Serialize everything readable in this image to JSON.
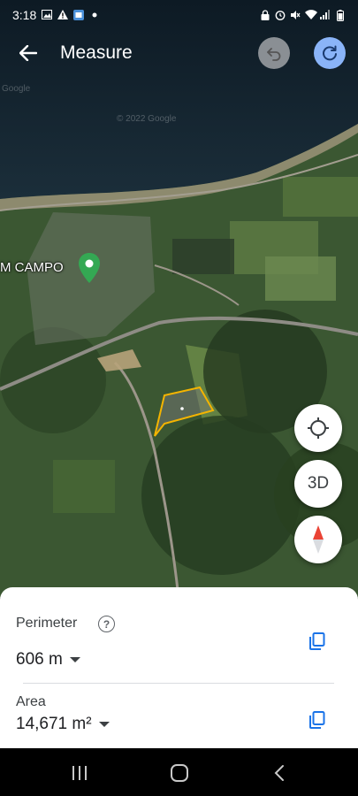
{
  "status_bar": {
    "time": "3:18",
    "left_icons": [
      "gallery-icon",
      "warning-icon",
      "app-icon",
      "dot-icon"
    ],
    "right_icons": [
      "lock-icon",
      "alarm-icon",
      "mute-icon",
      "wifi-icon",
      "signal-icon",
      "battery-icon"
    ]
  },
  "app_bar": {
    "title": "Measure",
    "back_icon": "arrow-back-icon",
    "undo_icon": "undo-icon",
    "redo_icon": "redo-icon"
  },
  "map": {
    "watermark_google": "Google",
    "watermark_copyright": "© 2022 Google",
    "poi_label": "M CAMPO",
    "poi_pin_color": "#34a853",
    "polygon_color": "#f4b400",
    "controls": {
      "location_icon": "my-location-icon",
      "three_d_label": "3D",
      "compass_icon": "compass-icon"
    }
  },
  "sheet": {
    "perimeter": {
      "label": "Perimeter",
      "value": "606 m",
      "help_icon": "help-icon",
      "copy_icon": "copy-icon"
    },
    "area": {
      "label": "Area",
      "value": "14,671 m²",
      "copy_icon": "copy-icon"
    },
    "accent_color": "#1a73e8"
  },
  "nav_bar": {
    "recents_icon": "recents-icon",
    "home_icon": "home-icon",
    "back_icon": "back-icon"
  }
}
